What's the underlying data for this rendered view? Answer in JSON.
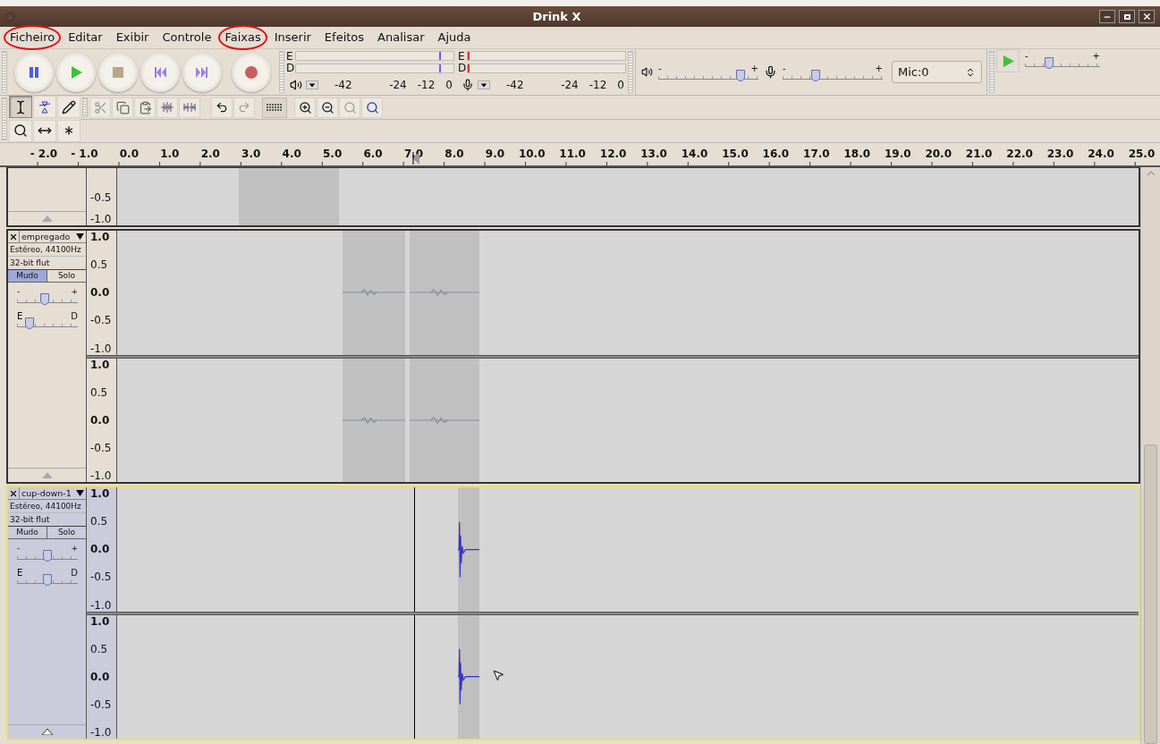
{
  "window": {
    "title": "Drink X"
  },
  "menu": [
    {
      "label": "Ficheiro",
      "circled": true
    },
    {
      "label": "Editar",
      "circled": false
    },
    {
      "label": "Exibir",
      "circled": false
    },
    {
      "label": "Controle",
      "circled": false
    },
    {
      "label": "Faixas",
      "circled": true
    },
    {
      "label": "Inserir",
      "circled": false
    },
    {
      "label": "Efeitos",
      "circled": false
    },
    {
      "label": "Analisar",
      "circled": false
    },
    {
      "label": "Ajuda",
      "circled": false
    }
  ],
  "tools": [
    {
      "kind": "select",
      "selected": true
    },
    {
      "kind": "envelope",
      "selected": false
    },
    {
      "kind": "draw",
      "selected": false
    },
    {
      "kind": "zoom",
      "selected": false
    },
    {
      "kind": "timeshift",
      "selected": false
    },
    {
      "kind": "multi",
      "selected": false
    }
  ],
  "meters": {
    "playback": {
      "channels": [
        {
          "label": "E",
          "level": 0.91
        },
        {
          "label": "D",
          "level": 0.91
        }
      ],
      "scale": [
        "-42",
        "-24",
        "-12",
        "0"
      ]
    },
    "record": {
      "channels": [
        {
          "label": "E",
          "level": 0
        },
        {
          "label": "D",
          "level": 0
        }
      ],
      "scale": [
        "-42",
        "-24",
        "-12",
        "0"
      ]
    }
  },
  "mixer": {
    "output": {
      "min_label": "-",
      "max_label": "+",
      "level": 0.82
    },
    "input": {
      "min_label": "-",
      "max_label": "+",
      "level": 0.33
    },
    "device": "Mic:0"
  },
  "play_at_speed": {
    "min_label": "-",
    "max_label": "+",
    "level": 0.32
  },
  "ruler": {
    "labels": [
      "- 2.0",
      "- 1.0",
      "0.0",
      "1.0",
      "2.0",
      "3.0",
      "4.0",
      "5.0",
      "6.0",
      "7.0",
      "8.0",
      "9.0",
      "10.0",
      "11.0",
      "12.0",
      "13.0",
      "14.0",
      "15.0",
      "16.0",
      "17.0",
      "18.0",
      "19.0",
      "20.0",
      "21.0",
      "22.0",
      "23.0",
      "24.0",
      "25.0"
    ]
  },
  "tracks": [
    {
      "channels": [
        {
          "scale": [
            "-0.5",
            "-1.0"
          ]
        }
      ]
    },
    {
      "name": "empregado",
      "format": "Estéreo, 44100Hz",
      "sample_format": "32-bit flut",
      "selected": false,
      "mute": {
        "label": "Mudo",
        "on": true
      },
      "solo": {
        "label": "Solo",
        "on": false
      },
      "gain": {
        "min_label": "-",
        "max_label": "+",
        "level": 0.45
      },
      "pan": {
        "min_label": "E",
        "max_label": "D",
        "level": 0.2
      },
      "channels": [
        {
          "scale": [
            "1.0",
            "0.5",
            "0.0",
            "-0.5",
            "-1.0"
          ]
        },
        {
          "scale": [
            "1.0",
            "0.5",
            "0.0",
            "-0.5",
            "-1.0"
          ]
        }
      ]
    },
    {
      "name": "cup-down-1",
      "format": "Estéreo, 44100Hz",
      "sample_format": "32-bit flut",
      "selected": true,
      "mute": {
        "label": "Mudo",
        "on": false
      },
      "solo": {
        "label": "Solo",
        "on": false
      },
      "gain": {
        "min_label": "-",
        "max_label": "+",
        "level": 0.5
      },
      "pan": {
        "min_label": "E",
        "max_label": "D",
        "level": 0.5
      },
      "channels": [
        {
          "scale": [
            "1.0",
            "0.5",
            "0.0",
            "-0.5",
            "-1.0"
          ]
        },
        {
          "scale": [
            "1.0",
            "0.5",
            "0.0",
            "-0.5",
            "-1.0"
          ]
        }
      ]
    }
  ]
}
